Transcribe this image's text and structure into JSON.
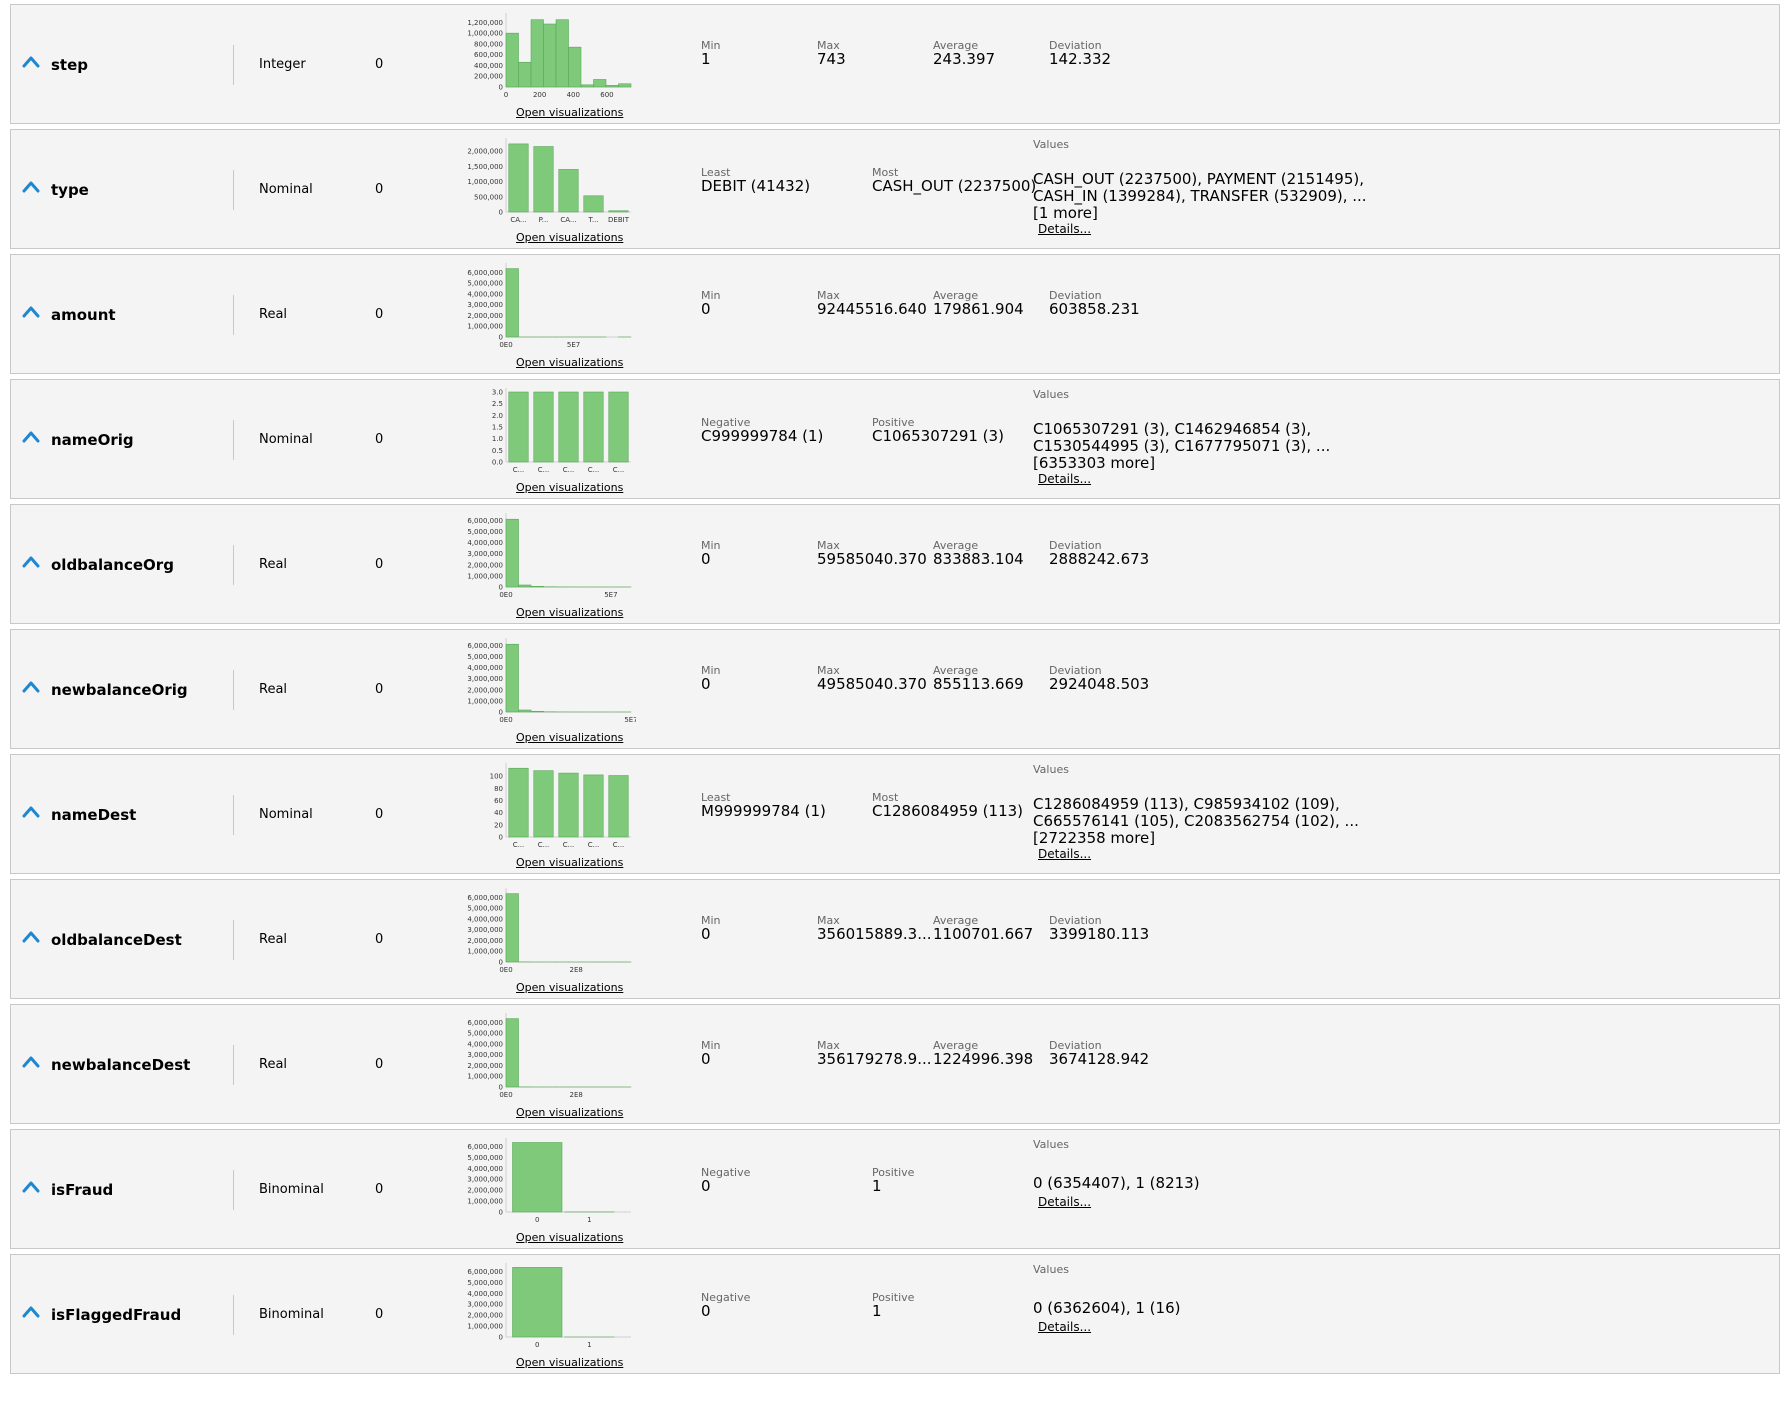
{
  "links": {
    "open_visualizations": "Open visualizations",
    "details": "Details..."
  },
  "colors": {
    "bar": "#7ec97a",
    "bar_edge": "#5aa957",
    "chevron": "#1e87d1"
  },
  "rows": [
    {
      "name": "step",
      "type": "Integer",
      "missing": "0",
      "stats": [
        {
          "label": "Min",
          "value": "1"
        },
        {
          "label": "Max",
          "value": "743"
        },
        {
          "label": "Average",
          "value": "243.397"
        },
        {
          "label": "Deviation",
          "value": "142.332"
        }
      ],
      "chart_data": {
        "type": "bar",
        "kind": "histogram",
        "values": [
          1000000,
          460000,
          1250000,
          1170000,
          1250000,
          740000,
          40000,
          140000,
          30000,
          60000
        ],
        "x_range": [
          0,
          743
        ],
        "x_ticks": [
          "0",
          "200",
          "400",
          "600"
        ],
        "y_max": 1300000,
        "y_ticks": [
          "1,200,000",
          "1,000,000",
          "800,000",
          "600,000",
          "400,000",
          "200,000",
          "0"
        ]
      }
    },
    {
      "name": "type",
      "type": "Nominal",
      "missing": "0",
      "stats": [
        {
          "label": "Least",
          "value": "DEBIT (41432)"
        },
        {
          "label": "Most",
          "value": "CASH_OUT (2237500)"
        }
      ],
      "values_label": "Values",
      "values_text": "CASH_OUT (2237500), PAYMENT (2151495), CASH_IN (1399284), TRANSFER (532909), ...[1 more]",
      "chart_data": {
        "type": "bar",
        "categories": [
          "CA...",
          "P...",
          "CA...",
          "T...",
          "DEBIT"
        ],
        "values": [
          2237500,
          2151495,
          1399284,
          532909,
          41432
        ],
        "y_max": 2300000,
        "y_ticks": [
          "2,000,000",
          "1,500,000",
          "1,000,000",
          "500,000",
          "0"
        ]
      }
    },
    {
      "name": "amount",
      "type": "Real",
      "missing": "0",
      "stats": [
        {
          "label": "Min",
          "value": "0"
        },
        {
          "label": "Max",
          "value": "92445516.640"
        },
        {
          "label": "Average",
          "value": "179861.904"
        },
        {
          "label": "Deviation",
          "value": "603858.231"
        }
      ],
      "chart_data": {
        "type": "bar",
        "kind": "histogram",
        "values": [
          6350000,
          500,
          100,
          20,
          5,
          2,
          1,
          1,
          0,
          1
        ],
        "x_range": [
          0,
          92445516.64
        ],
        "x_ticks": [
          "0E0",
          "5E7"
        ],
        "y_max": 6500000,
        "y_ticks": [
          "6,000,000",
          "5,000,000",
          "4,000,000",
          "3,000,000",
          "2,000,000",
          "1,000,000",
          "0"
        ]
      }
    },
    {
      "name": "nameOrig",
      "type": "Nominal",
      "missing": "0",
      "stats": [
        {
          "label": "Negative",
          "value": "C999999784 (1)"
        },
        {
          "label": "Positive",
          "value": "C1065307291 (3)"
        }
      ],
      "values_label": "Values",
      "values_text": "C1065307291 (3), C1462946854 (3), C1530544995 (3), C1677795071 (3), ...[6353303 more]",
      "chart_data": {
        "type": "bar",
        "categories": [
          "C...",
          "C...",
          "C...",
          "C...",
          "C..."
        ],
        "values": [
          3,
          3,
          3,
          3,
          3
        ],
        "y_max": 3,
        "y_ticks": [
          "3.0",
          "2.5",
          "2.0",
          "1.5",
          "1.0",
          "0.5",
          "0.0"
        ]
      }
    },
    {
      "name": "oldbalanceOrg",
      "type": "Real",
      "missing": "0",
      "stats": [
        {
          "label": "Min",
          "value": "0"
        },
        {
          "label": "Max",
          "value": "59585040.370"
        },
        {
          "label": "Average",
          "value": "833883.104"
        },
        {
          "label": "Deviation",
          "value": "2888242.673"
        }
      ],
      "chart_data": {
        "type": "bar",
        "kind": "histogram",
        "values": [
          6100000,
          180000,
          60000,
          20000,
          8000,
          3000,
          1000,
          500,
          200,
          100
        ],
        "x_range": [
          0,
          59585040.37
        ],
        "x_ticks": [
          "0E0",
          "5E7"
        ],
        "y_max": 6300000,
        "y_ticks": [
          "6,000,000",
          "5,000,000",
          "4,000,000",
          "3,000,000",
          "2,000,000",
          "1,000,000",
          "0"
        ]
      }
    },
    {
      "name": "newbalanceOrig",
      "type": "Real",
      "missing": "0",
      "stats": [
        {
          "label": "Min",
          "value": "0"
        },
        {
          "label": "Max",
          "value": "49585040.370"
        },
        {
          "label": "Average",
          "value": "855113.669"
        },
        {
          "label": "Deviation",
          "value": "2924048.503"
        }
      ],
      "chart_data": {
        "type": "bar",
        "kind": "histogram",
        "values": [
          6100000,
          180000,
          60000,
          20000,
          8000,
          3000,
          1000,
          500,
          200,
          100
        ],
        "x_range": [
          0,
          49585040.37
        ],
        "x_ticks": [
          "0E0",
          "5E7"
        ],
        "y_max": 6300000,
        "y_ticks": [
          "6,000,000",
          "5,000,000",
          "4,000,000",
          "3,000,000",
          "2,000,000",
          "1,000,000",
          "0"
        ]
      }
    },
    {
      "name": "nameDest",
      "type": "Nominal",
      "missing": "0",
      "stats": [
        {
          "label": "Least",
          "value": "M999999784 (1)"
        },
        {
          "label": "Most",
          "value": "C1286084959 (113)"
        }
      ],
      "values_label": "Values",
      "values_text": "C1286084959 (113), C985934102 (109), C665576141 (105), C2083562754 (102), ...[2722358 more]",
      "chart_data": {
        "type": "bar",
        "categories": [
          "C...",
          "C...",
          "C...",
          "C...",
          "C..."
        ],
        "values": [
          113,
          109,
          105,
          102,
          101
        ],
        "y_max": 115,
        "y_ticks": [
          "100",
          "80",
          "60",
          "40",
          "20",
          "0"
        ]
      }
    },
    {
      "name": "oldbalanceDest",
      "type": "Real",
      "missing": "0",
      "stats": [
        {
          "label": "Min",
          "value": "0"
        },
        {
          "label": "Max",
          "value": "356015889.3..."
        },
        {
          "label": "Average",
          "value": "1100701.667"
        },
        {
          "label": "Deviation",
          "value": "3399180.113"
        }
      ],
      "chart_data": {
        "type": "bar",
        "kind": "histogram",
        "values": [
          6350000,
          8000,
          1000,
          200,
          50,
          10,
          5,
          2,
          1,
          1
        ],
        "x_range": [
          0,
          356015889.3
        ],
        "x_ticks": [
          "0E0",
          "2E8"
        ],
        "y_max": 6500000,
        "y_ticks": [
          "6,000,000",
          "5,000,000",
          "4,000,000",
          "3,000,000",
          "2,000,000",
          "1,000,000",
          "0"
        ]
      }
    },
    {
      "name": "newbalanceDest",
      "type": "Real",
      "missing": "0",
      "stats": [
        {
          "label": "Min",
          "value": "0"
        },
        {
          "label": "Max",
          "value": "356179278.9..."
        },
        {
          "label": "Average",
          "value": "1224996.398"
        },
        {
          "label": "Deviation",
          "value": "3674128.942"
        }
      ],
      "chart_data": {
        "type": "bar",
        "kind": "histogram",
        "values": [
          6350000,
          8000,
          1000,
          200,
          50,
          10,
          5,
          2,
          1,
          1
        ],
        "x_range": [
          0,
          356179278.9
        ],
        "x_ticks": [
          "0E0",
          "2E8"
        ],
        "y_max": 6500000,
        "y_ticks": [
          "6,000,000",
          "5,000,000",
          "4,000,000",
          "3,000,000",
          "2,000,000",
          "1,000,000",
          "0"
        ]
      }
    },
    {
      "name": "isFraud",
      "type": "Binominal",
      "missing": "0",
      "stats": [
        {
          "label": "Negative",
          "value": "0"
        },
        {
          "label": "Positive",
          "value": "1"
        }
      ],
      "values_label": "Values",
      "values_text": "0 (6354407), 1 (8213)",
      "chart_data": {
        "type": "bar",
        "categories": [
          "0",
          "1"
        ],
        "values": [
          6354407,
          8213
        ],
        "y_max": 6400000,
        "y_ticks": [
          "6,000,000",
          "5,000,000",
          "4,000,000",
          "3,000,000",
          "2,000,000",
          "1,000,000",
          "0"
        ]
      }
    },
    {
      "name": "isFlaggedFraud",
      "type": "Binominal",
      "missing": "0",
      "stats": [
        {
          "label": "Negative",
          "value": "0"
        },
        {
          "label": "Positive",
          "value": "1"
        }
      ],
      "values_label": "Values",
      "values_text": "0 (6362604), 1 (16)",
      "chart_data": {
        "type": "bar",
        "categories": [
          "0",
          "1"
        ],
        "values": [
          6362604,
          16
        ],
        "y_max": 6400000,
        "y_ticks": [
          "6,000,000",
          "5,000,000",
          "4,000,000",
          "3,000,000",
          "2,000,000",
          "1,000,000",
          "0"
        ]
      }
    }
  ]
}
